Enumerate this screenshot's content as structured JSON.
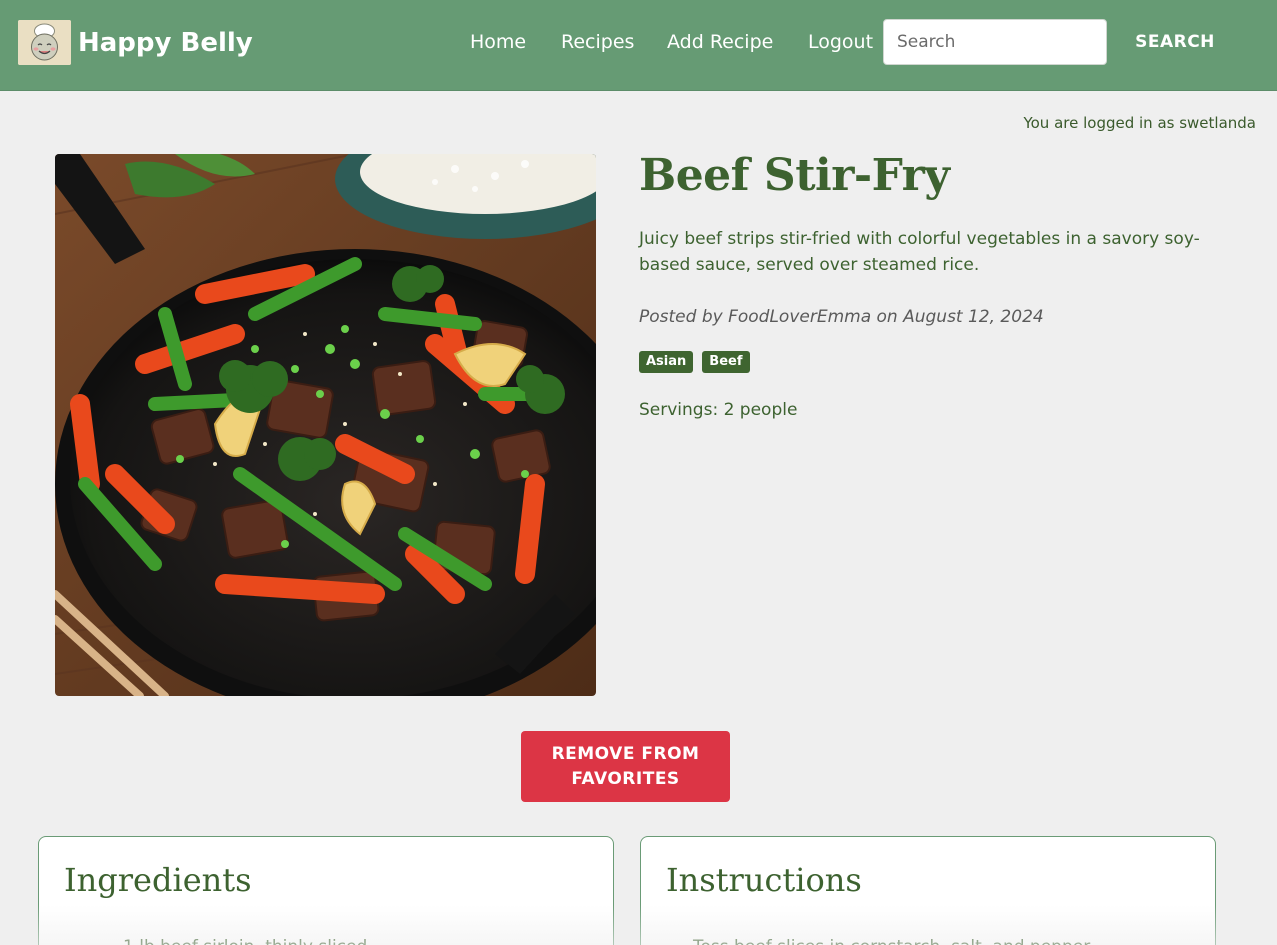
{
  "brand": {
    "name": "Happy Belly",
    "logo_icon": "chef-mascot-icon"
  },
  "nav": {
    "home": "Home",
    "recipes": "Recipes",
    "add_recipe": "Add Recipe",
    "logout": "Logout"
  },
  "search": {
    "placeholder": "Search",
    "value": "",
    "button_label": "SEARCH"
  },
  "session": {
    "logged_in_text": "You are logged in as swetlanda"
  },
  "recipe": {
    "title": "Beef Stir-Fry",
    "description": "Juicy beef strips stir-fried with colorful vegetables in a savory soy-based sauce, served over steamed rice.",
    "meta": "Posted by FoodLoverEmma on August 12, 2024",
    "tags": [
      "Asian",
      "Beef"
    ],
    "servings": "Servings: 2 people"
  },
  "actions": {
    "favorite_label": "REMOVE FROM\nFAVORITES"
  },
  "sections": {
    "ingredients": {
      "title": "Ingredients",
      "first_item": "1 lb beef sirloin, thinly sliced"
    },
    "instructions": {
      "title": "Instructions",
      "first_item": "Toss beef slices in cornstarch, salt, and pepper."
    }
  },
  "colors": {
    "navbar": "#669b74",
    "accent_green": "#3d6230",
    "danger": "#dc3545",
    "page_bg": "#efefef"
  }
}
